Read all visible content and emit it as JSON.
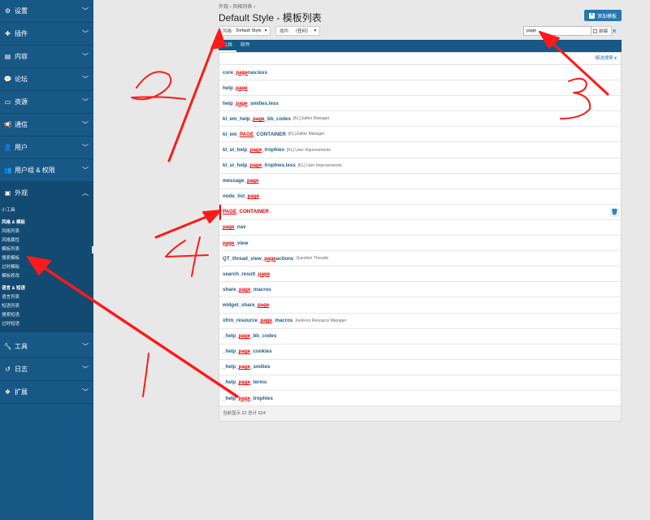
{
  "sidebar": {
    "items": [
      {
        "label": "设置",
        "icon": "gear-icon",
        "glyph": "⚙"
      },
      {
        "label": "插件",
        "icon": "puzzle-icon",
        "glyph": "✚"
      },
      {
        "label": "内容",
        "icon": "list-icon",
        "glyph": "▤"
      },
      {
        "label": "论坛",
        "icon": "comments-icon",
        "glyph": "💬"
      },
      {
        "label": "资源",
        "icon": "drive-icon",
        "glyph": "▭"
      },
      {
        "label": "通信",
        "icon": "megaphone-icon",
        "glyph": "📢"
      },
      {
        "label": "用户",
        "icon": "user-icon",
        "glyph": "👤"
      },
      {
        "label": "用户组 & 权限",
        "icon": "users-icon",
        "glyph": "👥"
      },
      {
        "label": "外观",
        "icon": "image-icon",
        "glyph": "▣"
      }
    ],
    "appearance": {
      "widgets": "小工具",
      "styles_header": "风格 & 模板",
      "style_links": [
        "风格列表",
        "风格属性",
        "模板列表",
        "搜索模板",
        "过时模板",
        "模板修改"
      ],
      "lang_header": "语言 & 短语",
      "lang_links": [
        "语言列表",
        "短语列表",
        "搜索短语",
        "过时短语"
      ]
    },
    "bottom_items": [
      {
        "label": "工具",
        "icon": "wrench-icon",
        "glyph": "🔧"
      },
      {
        "label": "日志",
        "icon": "history-icon",
        "glyph": "↺"
      },
      {
        "label": "扩展",
        "icon": "cubes-icon",
        "glyph": "❖"
      }
    ]
  },
  "breadcrumb": "外观 › 风格列表 ›",
  "page_title": "Default Style - 模板列表",
  "add_button": "添加模板",
  "filters": {
    "style_label": "风格:",
    "style_value": "Default Style",
    "addon_label": "插件:",
    "addon_value": "（任何）"
  },
  "search": {
    "value": "page",
    "prefix_label": "前缀",
    "clear": "✕"
  },
  "tabs": [
    "公共",
    "邮件"
  ],
  "refine_search": "精选搜索",
  "templates": [
    {
      "parts": [
        {
          "t": "core_"
        },
        {
          "t": "page",
          "hl": true
        },
        {
          "t": "nav.less"
        }
      ],
      "addon": ""
    },
    {
      "parts": [
        {
          "t": "help_"
        },
        {
          "t": "page",
          "hl": true
        }
      ],
      "addon": ""
    },
    {
      "parts": [
        {
          "t": "help_"
        },
        {
          "t": "page",
          "hl": true
        },
        {
          "t": "_smilies.less"
        }
      ],
      "addon": ""
    },
    {
      "parts": [
        {
          "t": "kl_em_help_"
        },
        {
          "t": "page",
          "hl": true
        },
        {
          "t": "_bb_codes"
        }
      ],
      "addon": "[KL] Editor Manager"
    },
    {
      "parts": [
        {
          "t": "kl_em_"
        },
        {
          "t": "PAGE",
          "hl": true
        },
        {
          "t": "_CONTAINER"
        }
      ],
      "addon": "[KL] Editor Manager"
    },
    {
      "parts": [
        {
          "t": "kl_ui_help_"
        },
        {
          "t": "page",
          "hl": true
        },
        {
          "t": "_trophies"
        }
      ],
      "addon": "[KL] User Improvements"
    },
    {
      "parts": [
        {
          "t": "kl_ui_help_"
        },
        {
          "t": "page",
          "hl": true
        },
        {
          "t": "_trophies.less"
        }
      ],
      "addon": "[KL] User Improvements"
    },
    {
      "parts": [
        {
          "t": "message_"
        },
        {
          "t": "page",
          "hl": true
        }
      ],
      "addon": ""
    },
    {
      "parts": [
        {
          "t": "node_list_"
        },
        {
          "t": "page",
          "hl": true
        }
      ],
      "addon": ""
    },
    {
      "parts": [
        {
          "t": "PAGE",
          "hl": true
        },
        {
          "t": "_CONTAINER"
        }
      ],
      "addon": "",
      "customized": true
    },
    {
      "parts": [
        {
          "t": "page",
          "hl": true
        },
        {
          "t": "_nav"
        }
      ],
      "addon": ""
    },
    {
      "parts": [
        {
          "t": "page",
          "hl": true
        },
        {
          "t": "_view"
        }
      ],
      "addon": ""
    },
    {
      "parts": [
        {
          "t": "QT_thread_view_"
        },
        {
          "t": "page",
          "hl": true
        },
        {
          "t": "actions"
        }
      ],
      "addon": "Question Threads"
    },
    {
      "parts": [
        {
          "t": "search_result_"
        },
        {
          "t": "page",
          "hl": true
        }
      ],
      "addon": ""
    },
    {
      "parts": [
        {
          "t": "share_"
        },
        {
          "t": "page",
          "hl": true
        },
        {
          "t": "_macros"
        }
      ],
      "addon": ""
    },
    {
      "parts": [
        {
          "t": "widget_share_"
        },
        {
          "t": "page",
          "hl": true
        }
      ],
      "addon": ""
    },
    {
      "parts": [
        {
          "t": "xfrm_resource_"
        },
        {
          "t": "page",
          "hl": true
        },
        {
          "t": "_macros"
        }
      ],
      "addon": "XenForo Resource Manager"
    },
    {
      "parts": [
        {
          "t": "_help_"
        },
        {
          "t": "page",
          "hl": true
        },
        {
          "t": "_bb_codes"
        }
      ],
      "addon": ""
    },
    {
      "parts": [
        {
          "t": "_help_"
        },
        {
          "t": "page",
          "hl": true
        },
        {
          "t": "_cookies"
        }
      ],
      "addon": ""
    },
    {
      "parts": [
        {
          "t": "_help_"
        },
        {
          "t": "page",
          "hl": true
        },
        {
          "t": "_smilies"
        }
      ],
      "addon": ""
    },
    {
      "parts": [
        {
          "t": "_help_"
        },
        {
          "t": "page",
          "hl": true
        },
        {
          "t": "_terms"
        }
      ],
      "addon": ""
    },
    {
      "parts": [
        {
          "t": "_help_"
        },
        {
          "t": "page",
          "hl": true
        },
        {
          "t": "_trophies"
        }
      ],
      "addon": ""
    }
  ],
  "footer": "当前显示 22 总计 624",
  "annotations": {
    "color": "#ff1a1a",
    "numbers": [
      "1",
      "2",
      "3",
      "4"
    ]
  }
}
